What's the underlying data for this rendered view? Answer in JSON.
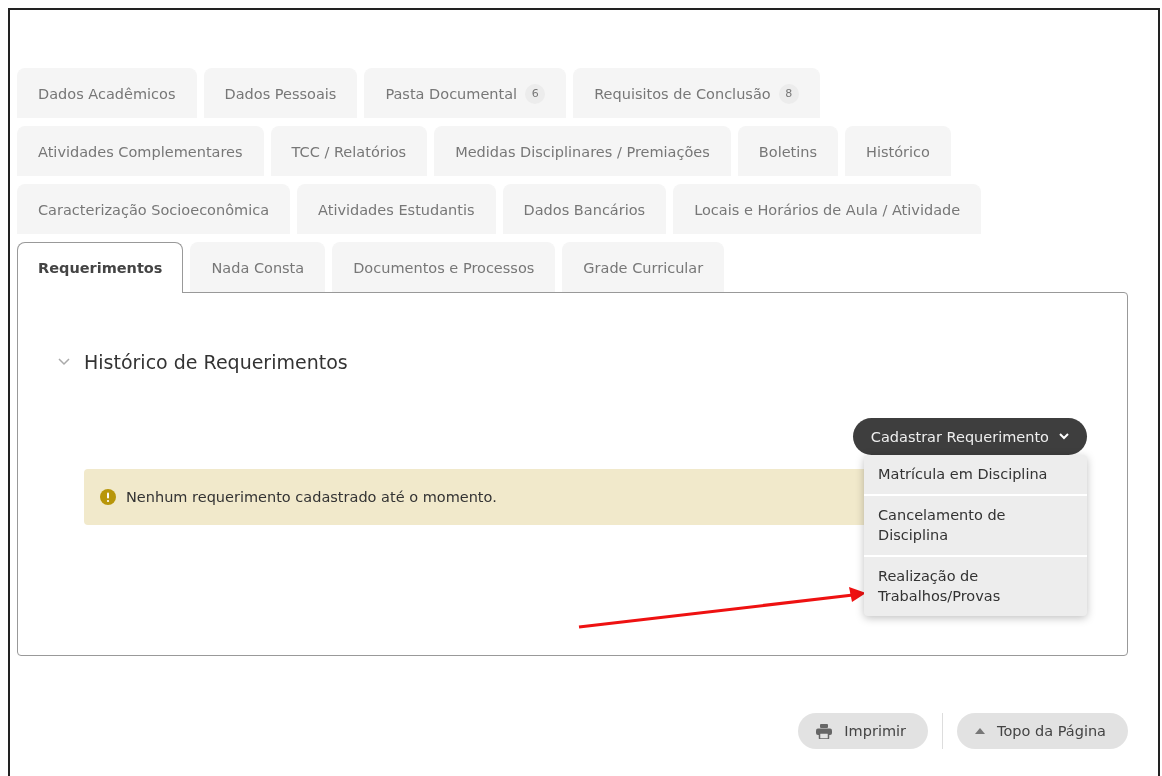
{
  "tab_rows": [
    [
      {
        "label": "Dados Acadêmicos",
        "selected": false
      },
      {
        "label": "Dados Pessoais",
        "selected": false
      },
      {
        "label": "Pasta Documental",
        "badge": "6",
        "selected": false
      },
      {
        "label": "Requisitos de Conclusão",
        "badge": "8",
        "selected": false
      }
    ],
    [
      {
        "label": "Atividades Complementares",
        "selected": false
      },
      {
        "label": "TCC / Relatórios",
        "selected": false
      },
      {
        "label": "Medidas Disciplinares / Premiações",
        "selected": false
      },
      {
        "label": "Boletins",
        "selected": false
      },
      {
        "label": "Histórico",
        "selected": false
      }
    ],
    [
      {
        "label": "Caracterização Socioeconômica",
        "selected": false
      },
      {
        "label": "Atividades Estudantis",
        "selected": false
      },
      {
        "label": "Dados Bancários",
        "selected": false
      },
      {
        "label": "Locais e Horários de Aula / Atividade",
        "selected": false
      }
    ],
    [
      {
        "label": "Requerimentos",
        "selected": true
      },
      {
        "label": "Nada Consta",
        "selected": false
      },
      {
        "label": "Documentos e Processos",
        "selected": false
      },
      {
        "label": "Grade Curricular",
        "selected": false
      }
    ]
  ],
  "section": {
    "title": "Histórico de Requerimentos",
    "expanded": true
  },
  "action_button": {
    "label": "Cadastrar Requerimento",
    "expanded": true
  },
  "dropdown_items": [
    "Matrícula em Disciplina",
    "Cancelamento de Disciplina",
    "Realização de Trabalhos/Provas"
  ],
  "alert": {
    "text": "Nenhum requerimento cadastrado até o momento."
  },
  "footer_buttons": [
    {
      "kind": "print",
      "label": "Imprimir"
    },
    {
      "kind": "top",
      "label": "Topo da Página"
    }
  ]
}
